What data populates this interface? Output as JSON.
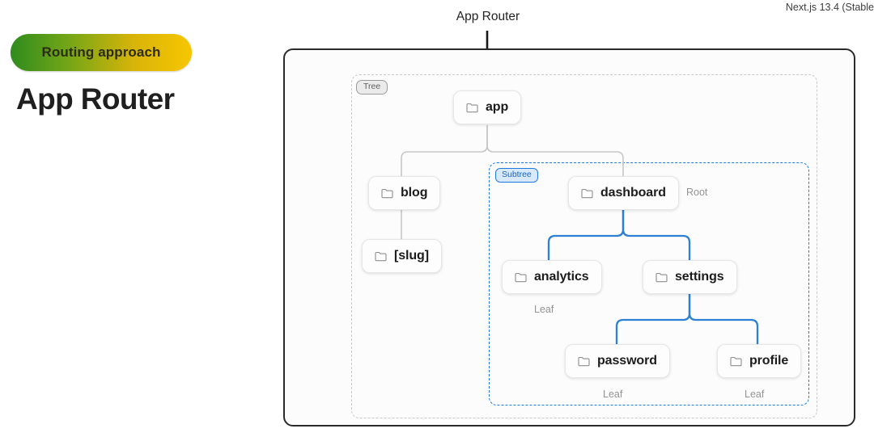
{
  "left_panel": {
    "badge_label": "Routing approach",
    "badge_gradient_from": "#2f8b1e",
    "badge_gradient_to": "#f7c600",
    "heading": "App Router"
  },
  "version_note": "Next.js 13.4 (Stable",
  "diagram": {
    "title": "App Router",
    "tree_tag": "Tree",
    "subtree_tag": "Subtree",
    "subtree_color": "#1f7ae0",
    "nodes": [
      {
        "id": "app",
        "label": "app",
        "icon": "folder-icon",
        "caption": ""
      },
      {
        "id": "blog",
        "label": "blog",
        "icon": "folder-icon",
        "caption": ""
      },
      {
        "id": "slug",
        "label": "[slug]",
        "icon": "folder-icon",
        "caption": ""
      },
      {
        "id": "dashboard",
        "label": "dashboard",
        "icon": "folder-icon",
        "caption": "Root"
      },
      {
        "id": "analytics",
        "label": "analytics",
        "icon": "folder-icon",
        "caption": "Leaf"
      },
      {
        "id": "settings",
        "label": "settings",
        "icon": "folder-icon",
        "caption": ""
      },
      {
        "id": "password",
        "label": "password",
        "icon": "folder-icon",
        "caption": "Leaf"
      },
      {
        "id": "profile",
        "label": "profile",
        "icon": "folder-icon",
        "caption": "Leaf"
      }
    ],
    "captions": {
      "root": "Root",
      "leaf_analytics": "Leaf",
      "leaf_password": "Leaf",
      "leaf_profile": "Leaf"
    }
  }
}
